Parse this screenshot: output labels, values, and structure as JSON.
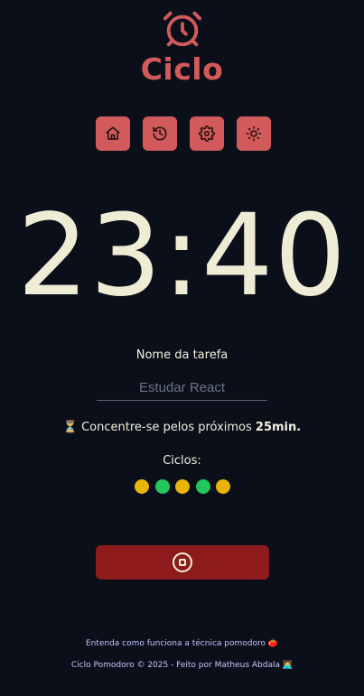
{
  "app": {
    "title": "Ciclo",
    "logo_icon": "alarm-clock-icon",
    "brand_color": "#d35a5a"
  },
  "nav": {
    "items": [
      {
        "icon": "home-icon"
      },
      {
        "icon": "history-icon"
      },
      {
        "icon": "gear-icon"
      },
      {
        "icon": "sun-icon"
      }
    ]
  },
  "timer": {
    "display": "23:40"
  },
  "task": {
    "label": "Nome da tarefa",
    "value": "",
    "placeholder": "Estudar React"
  },
  "focus": {
    "icon": "⏳",
    "text_before": "Concentre-se pelos próximos",
    "duration": "25min."
  },
  "cycles": {
    "label": "Ciclos:",
    "dots": [
      "work",
      "rest",
      "work",
      "rest",
      "work"
    ],
    "colors": {
      "work": "#eab308",
      "rest": "#22c55e"
    }
  },
  "stop_button": {
    "icon": "stop-circle-icon",
    "color": "#8e1b1b"
  },
  "footer": {
    "link_text": "Entenda como funciona a técnica pomodoro",
    "link_emoji": "🍅",
    "copyright": "Ciclo Pomodoro © 2025 - Feito por Matheus Abdala",
    "copyright_emoji": "🧑‍💻"
  }
}
